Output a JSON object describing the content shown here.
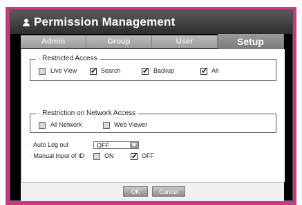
{
  "window": {
    "title": "Permission Management"
  },
  "tabs": [
    {
      "label": "Admin"
    },
    {
      "label": "Group"
    },
    {
      "label": "User"
    },
    {
      "label": "Setup"
    }
  ],
  "restricted_access": {
    "legend": "· Restricted Access",
    "items": [
      {
        "label": "Live View",
        "checked": false
      },
      {
        "label": "Search",
        "checked": true
      },
      {
        "label": "Backup",
        "checked": true
      },
      {
        "label": "All",
        "checked": true
      }
    ]
  },
  "network_access": {
    "legend": "· Restriction on Network Access",
    "items": [
      {
        "label": "All Network",
        "checked": false
      },
      {
        "label": "Web Viewer",
        "checked": false
      }
    ]
  },
  "auto_logout": {
    "label": "· Auto Log out",
    "value": "OFF"
  },
  "manual_input": {
    "label": "· Manual Input of ID",
    "on_label": "ON",
    "on_checked": false,
    "off_label": "OFF",
    "off_checked": true
  },
  "buttons": {
    "ok": "OK",
    "cancel": "Cancel"
  },
  "colors": {
    "frame": "#c33c7d",
    "title_bg": "#3a3a3a"
  },
  "icons": {
    "title": "user-icon",
    "dropdown": "dropdown-arrow-icon",
    "check": "checkmark-icon"
  }
}
